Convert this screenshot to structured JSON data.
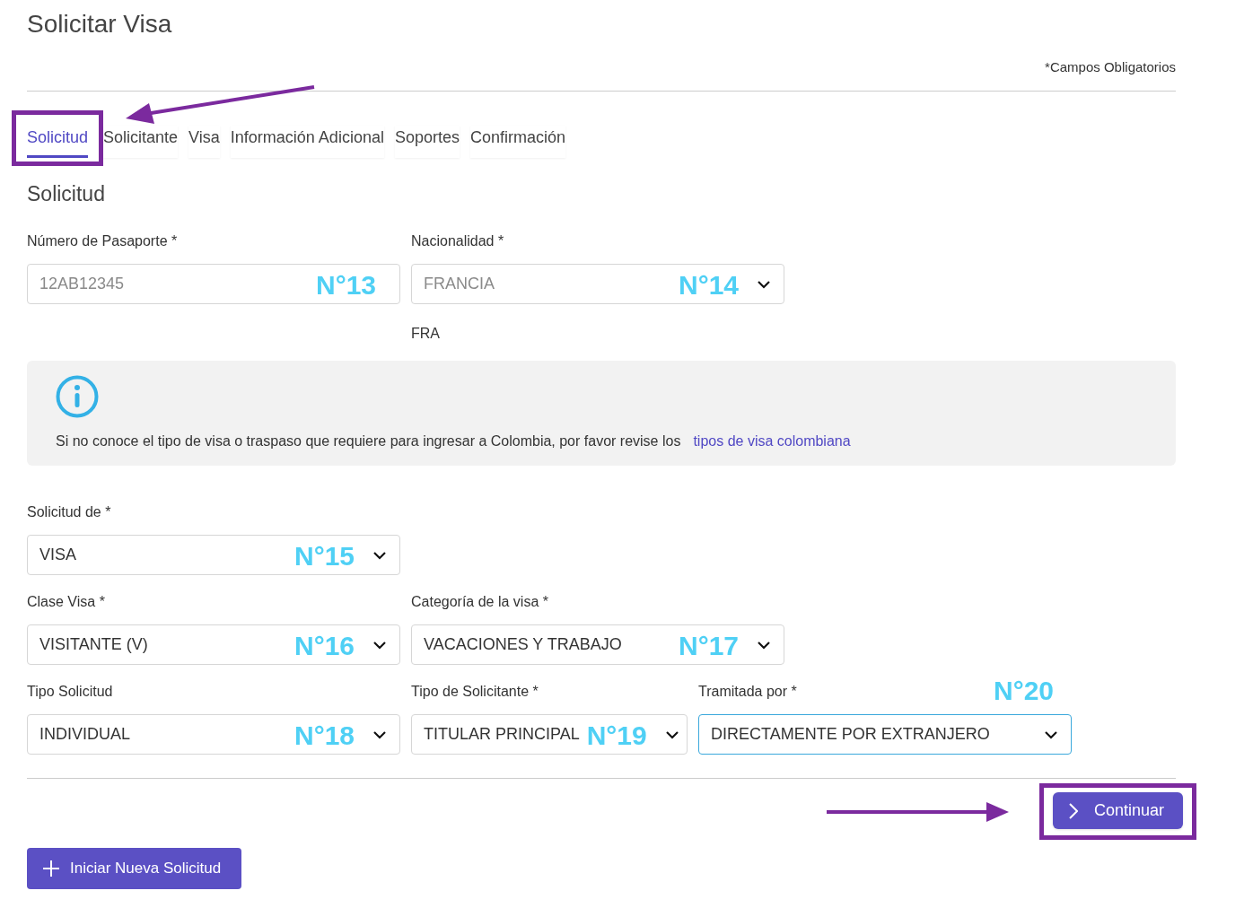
{
  "title": "Solicitar Visa",
  "required_note": "*Campos Obligatorios",
  "tabs": [
    {
      "label": "Solicitud",
      "selected": true,
      "highlighted": true
    },
    {
      "label": "Solicitante",
      "selected": false,
      "highlighted": false
    },
    {
      "label": "Visa",
      "selected": false,
      "highlighted": false
    },
    {
      "label": "Información Adicional",
      "selected": false,
      "highlighted": false
    },
    {
      "label": "Soportes",
      "selected": false,
      "highlighted": false
    },
    {
      "label": "Confirmación",
      "selected": false,
      "highlighted": false
    }
  ],
  "section_title": "Solicitud",
  "rows": [
    {
      "fields": [
        {
          "label": "Número de Pasaporte *",
          "value": "12AB12345",
          "kind": "input",
          "disabled": true,
          "focused": false,
          "tag": "N°13",
          "tag_above": false
        },
        {
          "label": "Nacionalidad *",
          "value": "FRANCIA",
          "kind": "select",
          "disabled": true,
          "focused": false,
          "tag": "N°14",
          "tag_above": false,
          "note": "FRA"
        }
      ]
    }
  ],
  "info": {
    "text": "Si no conoce el tipo de visa o traspaso que requiere para ingresar a Colombia, por favor revise los",
    "link": "tipos de visa colombiana"
  },
  "rows2": [
    {
      "fields": [
        {
          "label": "Solicitud de *",
          "value": "VISA",
          "kind": "select",
          "disabled": false,
          "focused": false,
          "tag": "N°15",
          "tag_above": false
        }
      ]
    },
    {
      "fields": [
        {
          "label": "Clase Visa *",
          "value": "VISITANTE (V)",
          "kind": "select",
          "disabled": false,
          "focused": false,
          "tag": "N°16",
          "tag_above": false
        },
        {
          "label": "Categoría de la visa *",
          "value": "VACACIONES Y TRABAJO",
          "kind": "select",
          "disabled": false,
          "focused": false,
          "tag": "N°17",
          "tag_above": false
        }
      ]
    },
    {
      "fields": [
        {
          "label": "Tipo Solicitud",
          "value": "INDIVIDUAL",
          "kind": "select",
          "disabled": false,
          "focused": false,
          "tag": "N°18",
          "tag_above": false
        },
        {
          "label": "Tipo de Solicitante *",
          "value": "TITULAR PRINCIPAL",
          "kind": "select",
          "disabled": false,
          "focused": false,
          "tag": "N°19",
          "tag_above": false,
          "narrow": true
        },
        {
          "label": "Tramitada por *",
          "value": "DIRECTAMENTE POR EXTRANJERO",
          "kind": "select",
          "disabled": false,
          "focused": true,
          "tag": "N°20",
          "tag_above": true
        }
      ]
    }
  ],
  "continue_button": {
    "label": "Continuar",
    "highlighted": true
  },
  "new_button": {
    "label": "Iniciar Nueva Solicitud"
  }
}
